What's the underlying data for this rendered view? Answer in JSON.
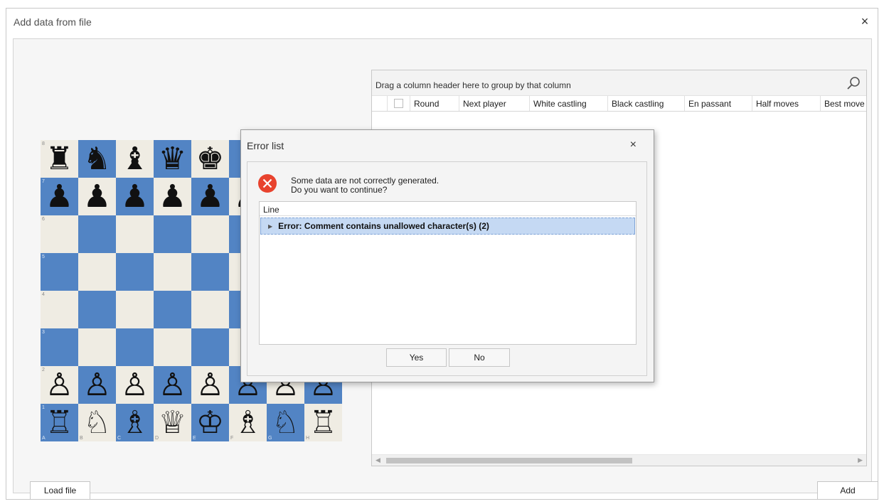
{
  "window": {
    "title": "Add data from file",
    "close_glyph": "×"
  },
  "board": {
    "ranks": [
      "8",
      "7",
      "6",
      "5",
      "4",
      "3",
      "2",
      "1"
    ],
    "files": [
      "A",
      "B",
      "C",
      "D",
      "E",
      "F",
      "G",
      "H"
    ],
    "rows": [
      [
        "♜",
        "♞",
        "♝",
        "♛",
        "♚",
        "♝",
        "♞",
        "♜"
      ],
      [
        "♟",
        "♟",
        "♟",
        "♟",
        "♟",
        "♟",
        "♟",
        "♟"
      ],
      [
        "",
        "",
        "",
        "",
        "",
        "",
        "",
        ""
      ],
      [
        "",
        "",
        "",
        "",
        "",
        "",
        "",
        ""
      ],
      [
        "",
        "",
        "",
        "",
        "",
        "",
        "",
        ""
      ],
      [
        "",
        "",
        "",
        "",
        "",
        "",
        "",
        ""
      ],
      [
        "♙",
        "♙",
        "♙",
        "♙",
        "♙",
        "♙",
        "♙",
        "♙"
      ],
      [
        "♖",
        "♘",
        "♗",
        "♕",
        "♔",
        "♗",
        "♘",
        "♖"
      ]
    ],
    "colors": {
      "light": "#efece3",
      "dark": "#5284c4"
    }
  },
  "grid": {
    "group_panel_text": "Drag a column header here to group by that column",
    "columns": [
      "Round",
      "Next player",
      "White castling",
      "Black castling",
      "En passant",
      "Half moves",
      "Best move"
    ]
  },
  "buttons": {
    "load_file": "Load file",
    "add": "Add"
  },
  "dialog": {
    "title": "Error list",
    "close_glyph": "×",
    "message_line1": "Some data are not correctly generated.",
    "message_line2": "Do you want to continue?",
    "list_header": "Line",
    "rows": [
      "Error: Comment contains unallowed character(s) (2)"
    ],
    "yes_label": "Yes",
    "no_label": "No",
    "error_color": "#e8432e"
  }
}
